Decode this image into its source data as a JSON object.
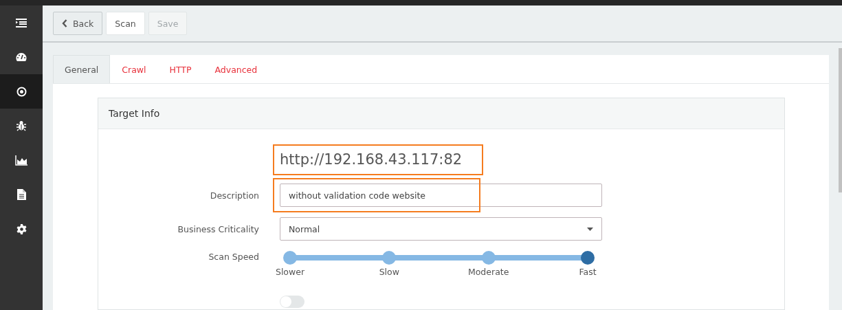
{
  "sidebar": {
    "items": [
      {
        "selected": false
      },
      {
        "selected": false
      },
      {
        "selected": true
      },
      {
        "selected": false
      },
      {
        "selected": false
      },
      {
        "selected": false
      },
      {
        "selected": false
      }
    ]
  },
  "toolbar": {
    "buttons": [
      {
        "label": "Back",
        "kind": "back",
        "disabled": false
      },
      {
        "label": "Scan",
        "kind": "primary",
        "disabled": false
      },
      {
        "label": "Save",
        "kind": "plain",
        "disabled": true
      }
    ]
  },
  "tabs": [
    {
      "label": "General",
      "selected": true
    },
    {
      "label": "Crawl",
      "selected": false
    },
    {
      "label": "HTTP",
      "selected": false
    },
    {
      "label": "Advanced",
      "selected": false
    }
  ],
  "panel": {
    "title": "Target Info",
    "target_url": {
      "text": "http://192.168.43.117:82",
      "highlighted": true
    },
    "fields": [
      {
        "kind": "text",
        "label": "Description",
        "value": "without validation code website",
        "highlighted": true
      },
      {
        "kind": "select",
        "label": "Business Criticality",
        "value": "Normal"
      }
    ],
    "scan_speed": {
      "label": "Scan Speed",
      "level": 1,
      "stops": [
        {
          "label": "Slower",
          "selected": false
        },
        {
          "label": "Slow",
          "selected": false
        },
        {
          "label": "Moderate",
          "selected": false
        },
        {
          "label": "Fast",
          "selected": true
        }
      ]
    },
    "toggle": {
      "on": false
    }
  }
}
